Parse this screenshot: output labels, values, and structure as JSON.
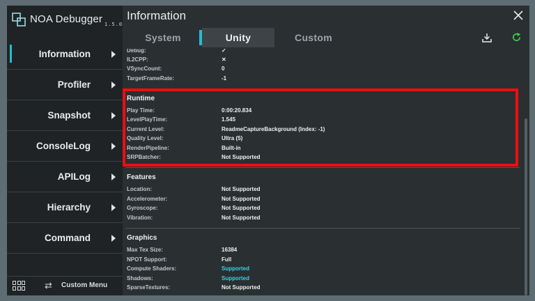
{
  "sidebar": {
    "app_name": "NOA Debugger",
    "version": "1.5.0",
    "items": [
      {
        "label": "Information"
      },
      {
        "label": "Profiler"
      },
      {
        "label": "Snapshot"
      },
      {
        "label": "ConsoleLog"
      },
      {
        "label": "APILog"
      },
      {
        "label": "Hierarchy"
      },
      {
        "label": "Command"
      }
    ],
    "custom_menu": "Custom Menu"
  },
  "header": {
    "title": "Information"
  },
  "tabs": [
    {
      "label": "System"
    },
    {
      "label": "Unity"
    },
    {
      "label": "Custom"
    }
  ],
  "sections": {
    "top": {
      "rows": [
        {
          "key": "Debug:",
          "value": "✓"
        },
        {
          "key": "IL2CPP:",
          "value": "✕"
        },
        {
          "key": "VSyncCount:",
          "value": "0"
        },
        {
          "key": "TargetFrameRate:",
          "value": "-1"
        }
      ]
    },
    "runtime": {
      "title": "Runtime",
      "rows": [
        {
          "key": "Play Time:",
          "value": "0:00:20.834"
        },
        {
          "key": "LevelPlayTime:",
          "value": "1.545"
        },
        {
          "key": "Current Level:",
          "value": "ReadmeCaptureBackground (Index: -1)"
        },
        {
          "key": "Quality Level:",
          "value": "Ultra (5)"
        },
        {
          "key": "RenderPipeline:",
          "value": "Built-in"
        },
        {
          "key": "SRPBatcher:",
          "value": "Not Supported"
        }
      ]
    },
    "features": {
      "title": "Features",
      "rows": [
        {
          "key": "Location:",
          "value": "Not Supported"
        },
        {
          "key": "Accelerometer:",
          "value": "Not Supported"
        },
        {
          "key": "Gyroscope:",
          "value": "Not Supported"
        },
        {
          "key": "Vibration:",
          "value": "Not Supported"
        }
      ]
    },
    "graphics": {
      "title": "Graphics",
      "rows": [
        {
          "key": "Max Tex Size:",
          "value": "16384"
        },
        {
          "key": "NPOT Support:",
          "value": "Full"
        },
        {
          "key": "Compute Shaders:",
          "value": "Supported"
        },
        {
          "key": "Shadows:",
          "value": "Supported"
        },
        {
          "key": "SparseTextures:",
          "value": "Not Supported"
        }
      ]
    }
  },
  "colors": {
    "accent": "#2ab9d3",
    "highlight": "#ef0d10",
    "supported": "#36d3e6",
    "refresh": "#3dd44a"
  }
}
